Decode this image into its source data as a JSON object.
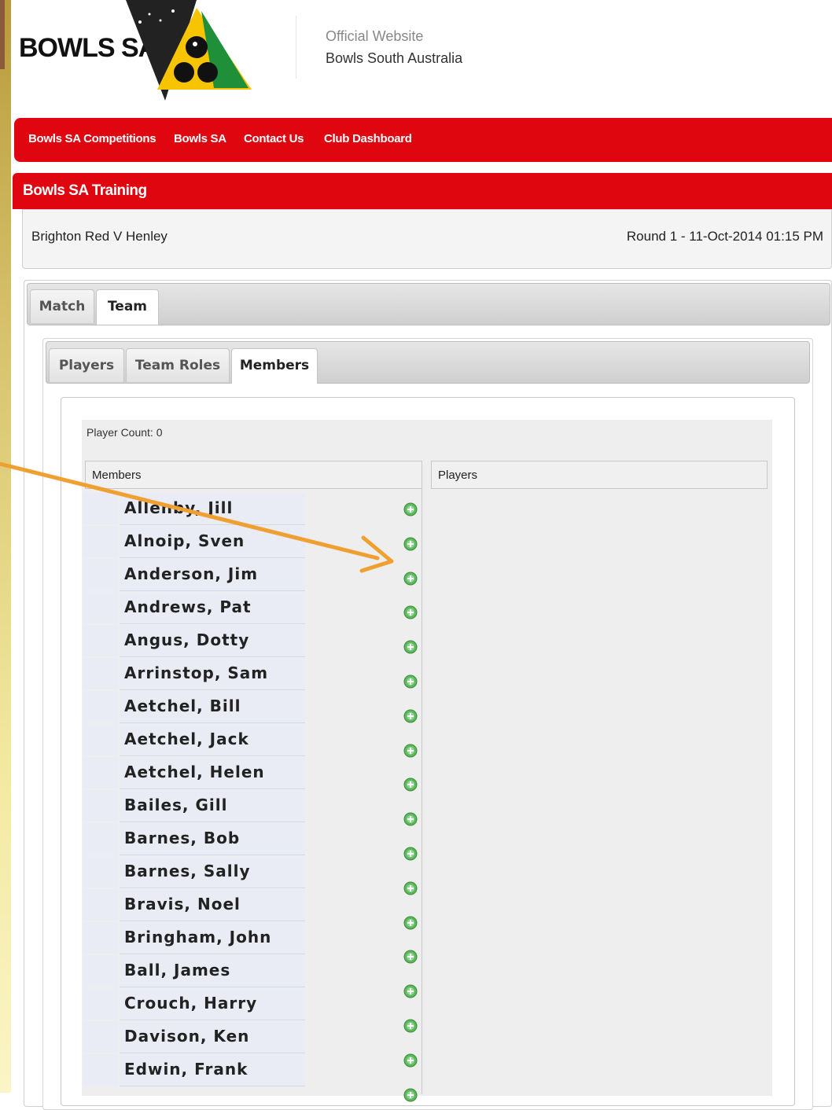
{
  "header": {
    "logo_text": "BOWLS SA",
    "tagline_line1": "Official Website",
    "tagline_line2": "Bowls South Australia"
  },
  "topnav": {
    "items": [
      {
        "label": "Bowls SA Competitions"
      },
      {
        "label": "Bowls SA"
      },
      {
        "label": "Contact Us"
      },
      {
        "label": "Club Dashboard"
      }
    ]
  },
  "section": {
    "title": "Bowls SA Training"
  },
  "match": {
    "title": "Brighton Red V Henley",
    "round": "Round 1 - 11-Oct-2014 01:15 PM"
  },
  "outer_tabs": [
    {
      "label": "Match",
      "active": false
    },
    {
      "label": "Team",
      "active": true
    }
  ],
  "inner_tabs": [
    {
      "label": "Players",
      "active": false
    },
    {
      "label": "Team Roles",
      "active": false
    },
    {
      "label": "Members",
      "active": true
    }
  ],
  "member_panel": {
    "player_count": "Player Count: 0",
    "members_header": "Members",
    "players_header": "Players",
    "add_icon": "add-circle-icon",
    "members": [
      "Allenby, Jill",
      "Alnoip, Sven",
      "Anderson, Jim",
      "Andrews, Pat",
      "Angus, Dotty",
      "Arrinstop, Sam",
      "Aetchel, Bill",
      "Aetchel, Jack",
      "Aetchel, Helen",
      "Bailes, Gill",
      "Barnes, Bob",
      "Barnes, Sally",
      "Bravis, Noel",
      "Bringham, John",
      "Ball, James",
      "Crouch, Harry",
      "Davison, Ken",
      "Edwin, Frank"
    ]
  },
  "colors": {
    "brand_red": "#e0060f",
    "arrow": "#f0a030",
    "add_green": "#5cb85c"
  }
}
